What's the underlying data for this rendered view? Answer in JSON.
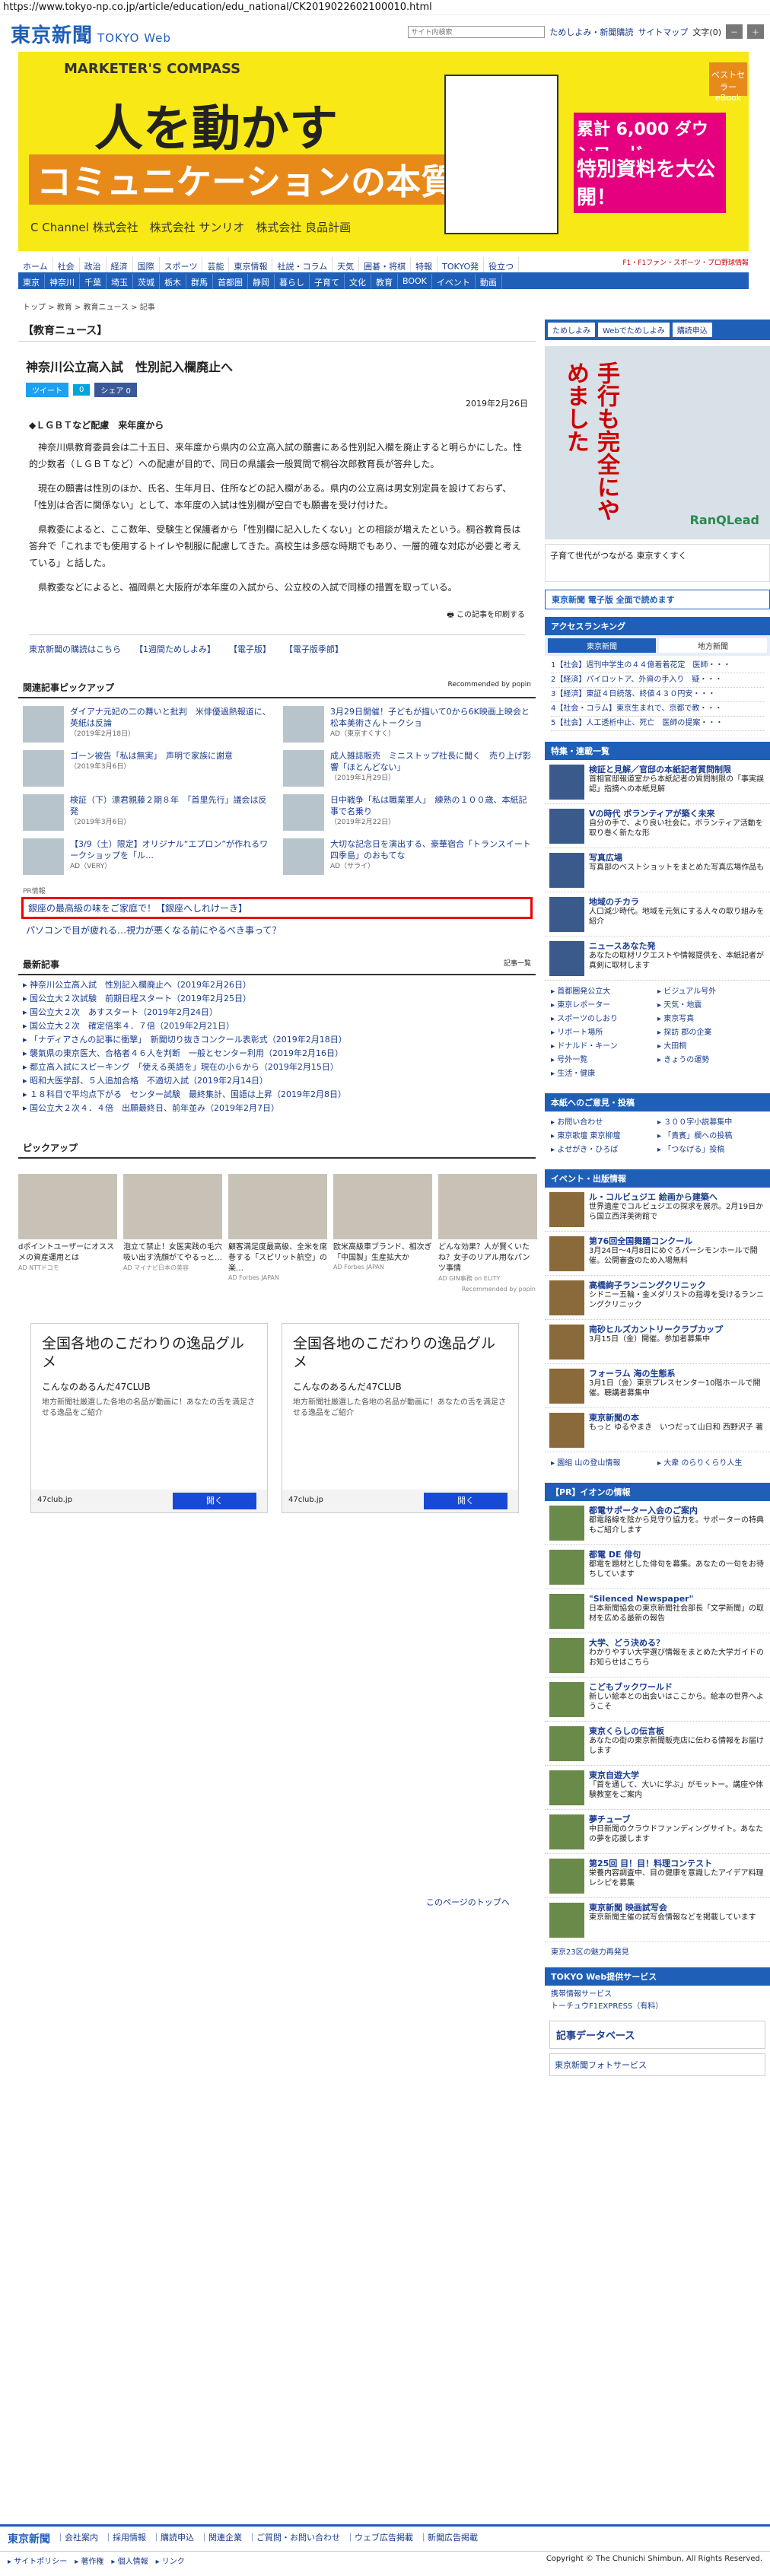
{
  "url": "https://www.tokyo-np.co.jp/article/education/edu_national/CK2019022602100010.html",
  "header": {
    "logo": "東京新聞",
    "logo_sub": "TOKYO Web",
    "search_placeholder": "サイト内検索",
    "nav": [
      "ためしよみ・新聞購読",
      "サイトマップ",
      "文字(0)"
    ],
    "font_minus": "－",
    "font_plus": "＋"
  },
  "ad_banner": {
    "tag": "MARKETER'S COMPASS",
    "headline1": "人を動かす",
    "headline2": "コミュニケーションの本質",
    "sponsors": "C Channel 株式会社　株式会社 サンリオ　株式会社 良品計画",
    "cta1": "累計 6,000 ダウンロード",
    "cta2": "特別資料を大公開！",
    "ebook": "ベストセラー eBook"
  },
  "cat_nav": {
    "row1": [
      "ホーム",
      "社会",
      "政治",
      "経済",
      "国際",
      "スポーツ",
      "芸能",
      "東京情報",
      "社説・コラム",
      "天気",
      "囲碁・将棋",
      "特報",
      "TOKYO発",
      "役立つ"
    ],
    "row2": [
      "東京",
      "神奈川",
      "千葉",
      "埼玉",
      "茨城",
      "栃木",
      "群馬",
      "首都圏",
      "静岡",
      "暮らし",
      "子育て",
      "文化",
      "教育",
      "BOOK",
      "イベント",
      "動画"
    ],
    "sports_label": "F1・F1ファン・スポーツ・プロ野球情報"
  },
  "breadcrumb": "トップ > 教育 > 教育ニュース > 記事",
  "article": {
    "section": "【教育ニュース】",
    "title": "神奈川公立高入試　性別記入欄廃止へ",
    "share": [
      "ツイート",
      "0",
      "シェア 0"
    ],
    "date": "2019年2月26日",
    "lead": "◆ＬＧＢＴなど配慮　来年度から",
    "paragraphs": [
      "神奈川県教育委員会は二十五日、来年度から県内の公立高入試の願書にある性別記入欄を廃止すると明らかにした。性的少数者（ＬＧＢＴなど）への配慮が目的で、同日の県議会一般質問で桐谷次郎教育長が答弁した。",
      "現在の願書は性別のほか、氏名、生年月日、住所などの記入欄がある。県内の公立高は男女別定員を設けておらず、「性別は合否に関係ない」として、本年度の入試は性別欄が空白でも願書を受け付けた。",
      "県教委によると、ここ数年、受験生と保護者から「性別欄に記入したくない」との相談が増えたという。桐谷教育長は答弁で「これまでも使用するトイレや制服に配慮してきた。高校生は多感な時期でもあり、一層的確な対応が必要と考えている」と話した。",
      "県教委などによると、福岡県と大阪府が本年度の入試から、公立校の入試で同様の措置を取っている。"
    ],
    "print_link": "この記事を印刷する",
    "links": [
      "東京新聞の購読はこちら",
      "【1週間ためしよみ】",
      "【電子版】",
      "【電子版季節】"
    ]
  },
  "related": {
    "title": "関連記事ピックアップ",
    "recommended": "Recommended by popin",
    "items": [
      {
        "text": "ダイアナ元妃の二の舞いと批判　米俳優過熱報道に、英紙は反論",
        "date": "（2019年2月18日）"
      },
      {
        "text": "3月29日開催！子どもが描いて0から6K映画上映会と松本美術さんトークショ",
        "date": "AD（東京すくすく）"
      },
      {
        "text": "ゴーン被告「私は無実」　声明で家族に謝意",
        "date": "（2019年3月6日）"
      },
      {
        "text": "成人雑誌販売　ミニストップ社長に聞く　売り上げ影響「ほとんどない」",
        "date": "（2019年1月29日）"
      },
      {
        "text": "検証（下）漂君親藤２期８年　「首里先行」議会は反発",
        "date": "（2019年3月6日）"
      },
      {
        "text": "日中戦争「私は職業軍人」　練熟の１００歳、本紙記事で名乗り",
        "date": "（2019年2月22日）"
      },
      {
        "text": "【3/9（土）限定】オリジナル“エプロン”が作れるワークショップを「ル…",
        "date": "AD（VERY）"
      },
      {
        "text": "大切な記念日を演出する、豪華宿合「トランスイート四季島」のおもてな",
        "date": "AD（サライ）"
      }
    ],
    "pr_label": "PR情報",
    "highlight": "銀座の最高級の味をご家庭で！【銀座へしれけーき】",
    "pr_line": "パソコンで目が疲れる…視力が悪くなる前にやるべき事って？"
  },
  "latest": {
    "title": "最新記事",
    "badge": "記事一覧",
    "items": [
      "神奈川公立高入試　性別記入欄廃止へ（2019年2月26日）",
      "国公立大２次試験　前期日程スタート（2019年2月25日）",
      "国公立大２次　あすスタート（2019年2月24日）",
      "国公立大２次　確定倍率４．７倍（2019年2月21日）",
      "「ナディアさんの記事に衝撃」　新聞切り抜きコンクール表彰式（2019年2月18日）",
      "襲氣県の東京医大、合格者４６人を判断　一般とセンター利用（2019年2月16日）",
      "都立高入試にスピーキング　「使える英語を」現在の小６から（2019年2月15日）",
      "昭和大医学部、５人追加合格　不適切入試（2019年2月14日）",
      "１８科目で平均点下がる　センター試験　最終集計、国語は上昇（2019年2月8日）",
      "国公立大２次４．４倍　出願最終日、前年並み（2019年2月7日）"
    ]
  },
  "pickup": {
    "title": "ピックアップ",
    "items": [
      {
        "text": "dポイントユーザーにオススメの資産運用とは",
        "src": "AD NTTドコモ"
      },
      {
        "text": "泡立て禁止！女医実践の毛穴吸い出す洗顔がてやるっと…",
        "src": "AD マイナビ日本の美容"
      },
      {
        "text": "顧客満足度最高級、全米を席巻する「スピリット航空」の楽…",
        "src": "AD Forbes JAPAN"
      },
      {
        "text": "欧米高級車ブランド、相次ぎ「中国製」生産拡大か",
        "src": "AD Forbes JAPAN"
      },
      {
        "text": "どんな効果？人が賢くいたね？女子のリアル用なパンツ事情",
        "src": "AD GIN事務 on ELITY"
      }
    ],
    "recommended": "Recommended by popin"
  },
  "ads": [
    {
      "heading": "全国各地のこだわりの逸品グルメ",
      "sub": "こんなのあるんだ47CLUB",
      "desc": "地方新聞社厳選した各地の名品が動画に！あなたの舌を満足させる逸品をご紹介",
      "domain": "47club.jp",
      "button": "開く"
    },
    {
      "heading": "全国各地のこだわりの逸品グルメ",
      "sub": "こんなのあるんだ47CLUB",
      "desc": "地方新聞社厳選した各地の名品が動画に！あなたの舌を満足させる逸品をご紹介",
      "domain": "47club.jp",
      "button": "開く"
    }
  ],
  "page_top": "このページのトップへ",
  "sidebar": {
    "buttons": [
      "ためしよみ",
      "Webでためしよみ",
      "購読申込"
    ],
    "ad_vertical": "手行も完全にやめました",
    "ad_brand": "RanQLead",
    "sukusuku": "子育て世代がつながる 東京すくすく",
    "shimbun_btn": "東京新聞 電子版 全面で読めます",
    "access_title": "アクセスランキング",
    "rank_tabs": [
      "東京新聞",
      "地方新聞"
    ],
    "ranking": [
      "1【社会】週刊中学生の４４億着着花定　医師・・・",
      "2【経済】パイロットア、外資の手入り　疑・・・",
      "3【経済】東証４日続落、終値４３０円安・・・",
      "4【社会・コラム】東京生まれで、京都で教・・・",
      "5【社会】人工透析中止、死亡　医師の提案・・・"
    ],
    "features_title": "特集・連載一覧",
    "features": [
      {
        "title": "検証と見解／官邸の本紙記者質問制限",
        "desc": "首相官邸報道室から本紙記者の質問制限の「事実誤認」指摘への本紙見解"
      },
      {
        "title": "Vの時代 ボランティアが築く未来",
        "desc": "自分の手で、より良い社会に。ボランティア活動を取り巻く新たな形"
      },
      {
        "title": "写真広場",
        "desc": "写真部のベストショットをまとめた写真広場作品も"
      },
      {
        "title": "地域のチカラ",
        "desc": "人口減少時代。地域を元気にする人々の取り組みを紹介"
      },
      {
        "title": "ニュースあなた発",
        "desc": "あなたの取材リクエストや情報提供を、本紙記者が真剣に取材します"
      }
    ],
    "links": [
      "首都圏発公立大",
      "ビジュアル号外",
      "東京レポーター",
      "天気・地震",
      "スポーツのしおり",
      "東京写真",
      "リボート場所",
      "探訪 郡の企業",
      "ドナルド・キーン",
      "大田桐",
      "号外一覧",
      "きょうの運勢",
      "生活・健康"
    ],
    "opinion_title": "本紙へのご意見・投稿",
    "opinion_links": [
      "お問い合わせ",
      "３００字小説募集中",
      "東京歌壇 東京柳壇",
      "「貴賓」欄への投稿",
      "よせがき・ひろば",
      "「つなげる」投稿"
    ],
    "events_title": "イベント・出版情報",
    "events": [
      {
        "title": "ル・コルビュジエ 絵画から建築へ",
        "desc": "世界遺産でコルビュジエの探求を展示。2月19日から国立西洋美術館で"
      },
      {
        "title": "第76回全国舞踊コンクール",
        "desc": "3月24日～4月8日にめぐろパーシモンホールで開催。公開審査のため入場無料"
      },
      {
        "title": "高橋絢子ランニングクリニック",
        "desc": "シドニー五輪・金メダリストの指導を受けるランニングクリニック"
      },
      {
        "title": "南砂ヒルズカントリークラブカップ",
        "desc": "3月15日（金）開催。参加者募集中"
      },
      {
        "title": "フォーラム 海の生態系",
        "desc": "3月1日（金）東京プレスセンター10階ホールで開催。聴講者募集中"
      },
      {
        "title": "東京新聞の本",
        "desc": "もっと ゆるやまき　いつだって山日和 西野沢子 著"
      }
    ],
    "book_links": [
      "園組 山の登山情報",
      "大衆 のらりくらり人生"
    ],
    "ion_title": "【PR】イオンの情報",
    "ion": [
      {
        "title": "都電サポーター入会のご案内",
        "desc": "都電路線を陰から見守り協力を。サポーターの特典もご紹介します"
      },
      {
        "title": "都電 DE 俳句",
        "desc": "都電を題材とした俳句を募集。あなたの一句をお待ちしています"
      },
      {
        "title": "\"Silenced Newspaper\"",
        "desc": "日本新聞協会の東京新聞社会部長「文学新聞」の取材を広める最新の報告"
      },
      {
        "title": "大学、どう決める？",
        "desc": "わかりやすい大学選び情報をまとめた大学ガイドのお知らせはこちら"
      },
      {
        "title": "こどもブックワールド",
        "desc": "新しい絵本との出会いはここから。絵本の世界へようこそ"
      },
      {
        "title": "東京くらしの伝言板",
        "desc": "あなたの街の東京新聞販売店に伝わる情報をお届けします"
      },
      {
        "title": "東京自遊大学",
        "desc": "「首を通して、大いに学ぶ」がモットー。講座や体験教室をご案内"
      },
      {
        "title": "夢チューブ",
        "desc": "中日新聞のクラウドファンディングサイト。あなたの夢を応援します"
      },
      {
        "title": "第25回 目！目！料理コンテスト",
        "desc": "栄養内容調査中、目の健康を意識したアイデア料理レシピを募集"
      },
      {
        "title": "東京新聞 映画試写会",
        "desc": "東京新聞主催の試写会情報などを掲載しています"
      }
    ],
    "more": "東京23区の魅力再発見",
    "service_title": "TOKYO Web提供サービス",
    "services": [
      "携帯情報サービス",
      "トーチュウF1EXPRESS（有料）"
    ],
    "db_btn": "記事データベース",
    "photo_btn": "東京新聞フォトサービス"
  },
  "footer": {
    "logo": "東京新聞",
    "links": [
      "会社案内",
      "採用情報",
      "購読申込",
      "関連企業",
      "ご質問・お問い合わせ",
      "ウェブ広告掲載",
      "新聞広告掲載"
    ],
    "bottom_links": [
      "サイトポリシー",
      "著作権",
      "個人情報",
      "リンク"
    ],
    "copyright": "Copyright © The Chunichi Shimbun, All Rights Reserved."
  }
}
